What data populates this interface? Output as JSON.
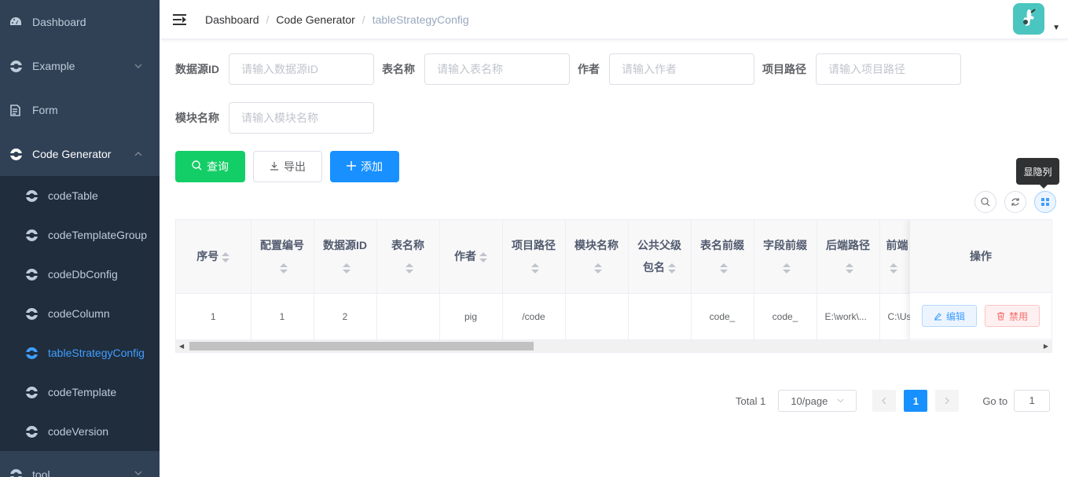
{
  "sidebar": {
    "items": [
      {
        "label": "Dashboard",
        "icon": "dashboard-icon"
      },
      {
        "label": "Example",
        "icon": "example-icon"
      },
      {
        "label": "Form",
        "icon": "form-icon"
      },
      {
        "label": "Code Generator",
        "icon": "code-generator-icon"
      },
      {
        "label": "tool",
        "icon": "tool-icon"
      }
    ],
    "sub_items": [
      "codeTable",
      "codeTemplateGroup",
      "codeDbConfig",
      "codeColumn",
      "tableStrategyConfig",
      "codeTemplate",
      "codeVersion"
    ],
    "active": "tableStrategyConfig"
  },
  "breadcrumb": [
    "Dashboard",
    "Code Generator",
    "tableStrategyConfig"
  ],
  "search": {
    "fields": [
      {
        "label": "数据源ID",
        "placeholder": "请输入数据源ID"
      },
      {
        "label": "表名称",
        "placeholder": "请输入表名称"
      },
      {
        "label": "作者",
        "placeholder": "请输入作者"
      },
      {
        "label": "项目路径",
        "placeholder": "请输入项目路径"
      },
      {
        "label": "模块名称",
        "placeholder": "请输入模块名称"
      }
    ],
    "query_label": "查询",
    "export_label": "导出",
    "add_label": "添加"
  },
  "toolbar": {
    "tooltip": "显隐列"
  },
  "table": {
    "columns": [
      "序号",
      "配置编号",
      "数据源ID",
      "表名称",
      "作者",
      "项目路径",
      "模块名称",
      "公共父级包名",
      "表名前缀",
      "字段前缀",
      "后端路径",
      "前端"
    ],
    "ops_header": "操作",
    "rows": [
      [
        "1",
        "1",
        "2",
        "",
        "pig",
        "/code",
        "",
        "",
        "code_",
        "code_",
        "E:\\work\\...",
        "C:\\Us"
      ]
    ],
    "edit_label": "编辑",
    "disable_label": "禁用"
  },
  "pagination": {
    "total": "Total 1",
    "page_size": "10/page",
    "current": "1",
    "goto_label": "Go to",
    "goto_value": "1"
  },
  "colors": {
    "sidebar_bg": "#304156",
    "active": "#409eff",
    "primary": "#1890ff",
    "success": "#13ce66"
  }
}
